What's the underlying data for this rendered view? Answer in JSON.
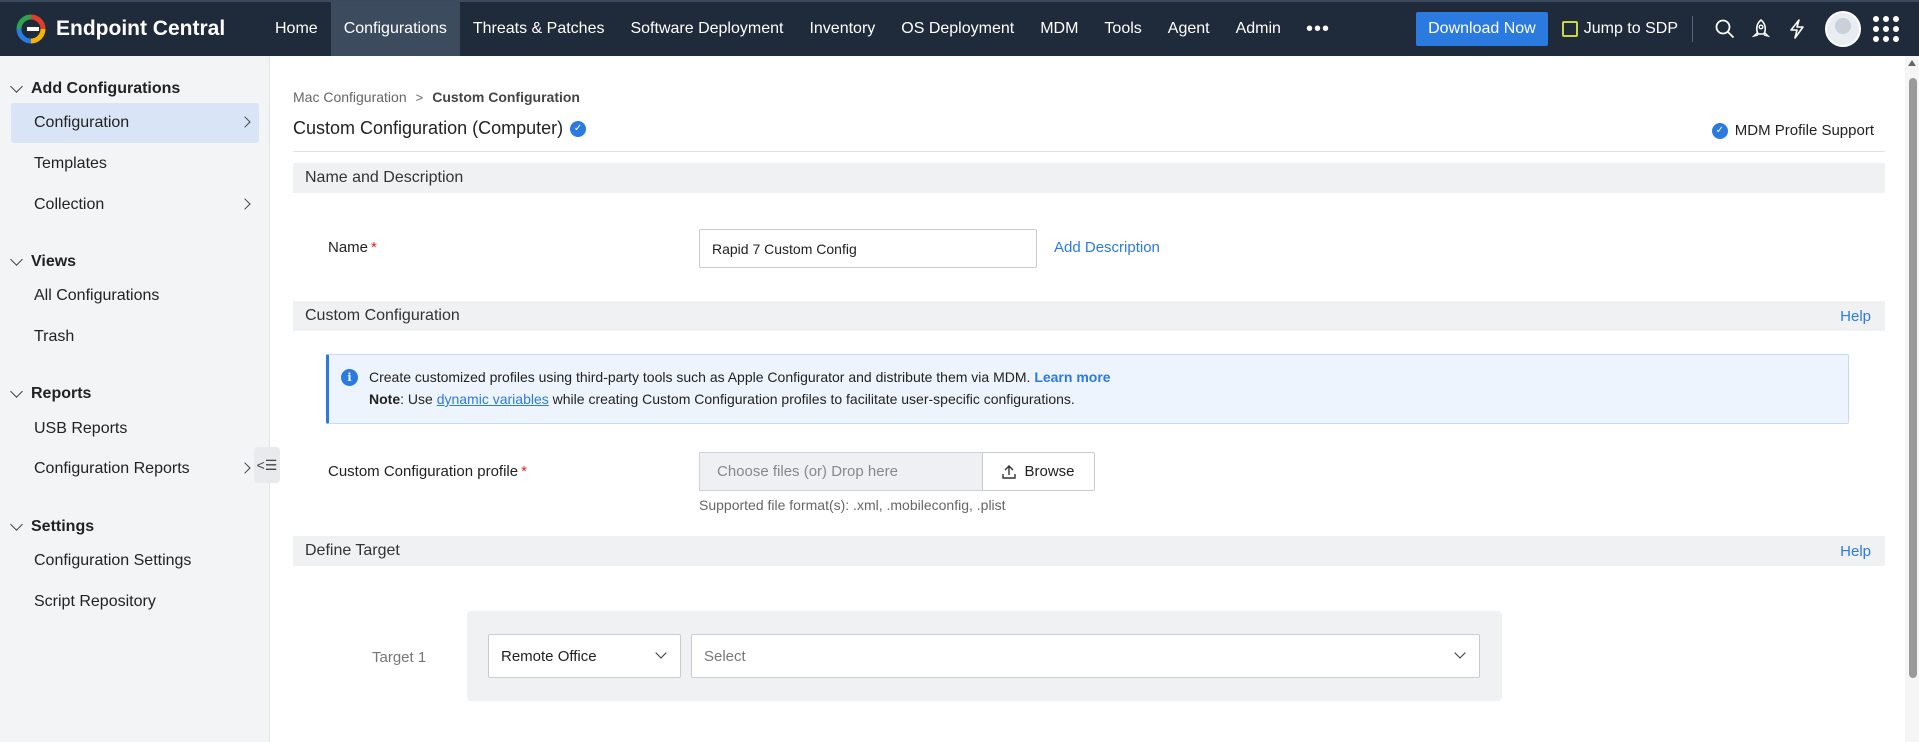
{
  "app": {
    "name": "Endpoint Central"
  },
  "nav": {
    "items": [
      {
        "label": "Home"
      },
      {
        "label": "Configurations"
      },
      {
        "label": "Threats & Patches"
      },
      {
        "label": "Software Deployment"
      },
      {
        "label": "Inventory"
      },
      {
        "label": "OS Deployment"
      },
      {
        "label": "MDM"
      },
      {
        "label": "Tools"
      },
      {
        "label": "Agent"
      },
      {
        "label": "Admin"
      }
    ],
    "active_index": 1,
    "more_label": "•••",
    "download_label": "Download Now",
    "jump_label": "Jump to SDP",
    "icons": [
      "search-icon",
      "rocket-icon",
      "lightning-icon",
      "avatar",
      "apps-grid-icon"
    ]
  },
  "sidebar": {
    "add_configurations": {
      "title": "Add Configurations",
      "items": [
        {
          "label": "Configuration"
        },
        {
          "label": "Templates"
        },
        {
          "label": "Collection"
        }
      ]
    },
    "views": {
      "title": "Views",
      "items": [
        {
          "label": "All Configurations"
        },
        {
          "label": "Trash"
        }
      ]
    },
    "reports": {
      "title": "Reports",
      "items": [
        {
          "label": "USB Reports"
        },
        {
          "label": "Configuration Reports"
        }
      ]
    },
    "settings": {
      "title": "Settings",
      "items": [
        {
          "label": "Configuration Settings"
        },
        {
          "label": "Script Repository"
        }
      ]
    },
    "collapse_glyph": "<☰"
  },
  "breadcrumb": {
    "parent": "Mac Configuration",
    "separator": ">",
    "current": "Custom Configuration"
  },
  "page": {
    "title": "Custom Configuration (Computer)",
    "mdm_support": "MDM Profile Support",
    "badge_glyph": "✓"
  },
  "sections": {
    "name_desc": {
      "title": "Name and Description",
      "name_label": "Name",
      "required_mark": "*",
      "name_value": "Rapid 7 Custom Config",
      "add_description": "Add Description"
    },
    "custom_config": {
      "title": "Custom Configuration",
      "help": "Help",
      "info_glyph": "i",
      "info_text": "Create customized profiles using third-party tools such as Apple Configurator and distribute them via MDM.",
      "learn_more": "Learn more",
      "note_label": "Note",
      "note_pre": ": Use",
      "note_link": "dynamic variables",
      "note_post": "while creating Custom Configuration profiles to facilitate user-specific configurations.",
      "profile_label": "Custom Configuration profile",
      "drop_placeholder": "Choose files (or) Drop here",
      "browse_label": "Browse",
      "supported_formats": "Supported file format(s): .xml, .mobileconfig, .plist"
    },
    "define_target": {
      "title": "Define Target",
      "help": "Help",
      "target_label": "Target 1",
      "target_type": "Remote Office",
      "target_value_placeholder": "Select"
    }
  },
  "colors": {
    "topbar": "#1f2a3a",
    "accent": "#2b7ae0",
    "active_nav": "#3d4b5f",
    "sidebar_active": "#d9e4f7"
  }
}
